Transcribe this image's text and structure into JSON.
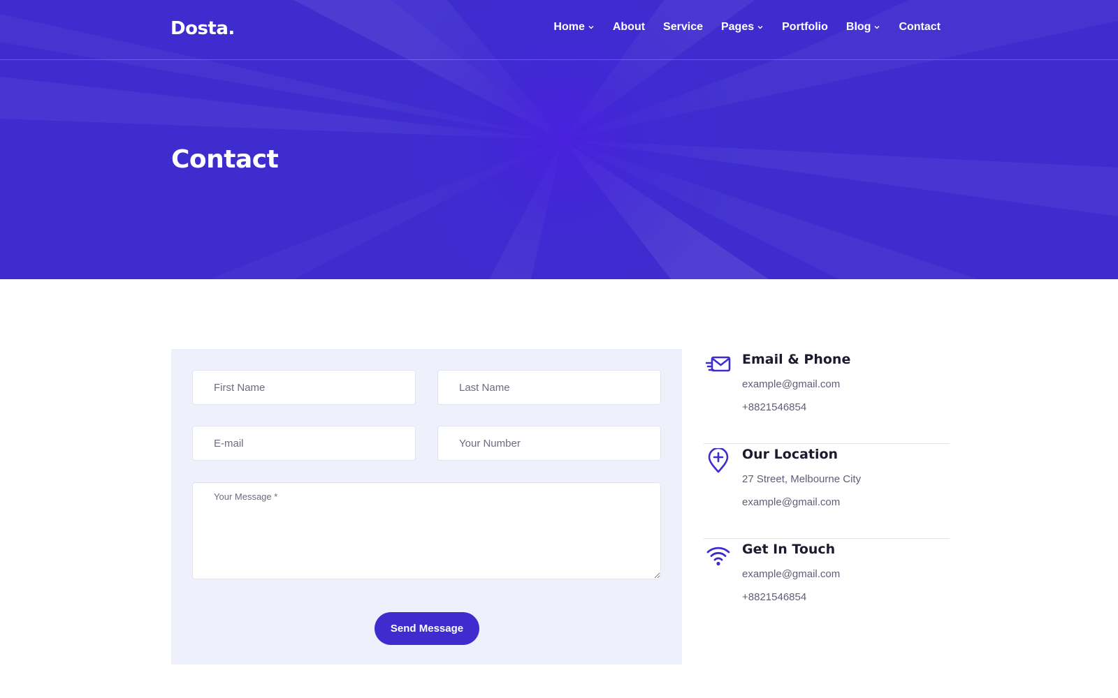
{
  "header": {
    "logo": "Dosta.",
    "nav": [
      {
        "label": "Home",
        "has_dropdown": true
      },
      {
        "label": "About",
        "has_dropdown": false
      },
      {
        "label": "Service",
        "has_dropdown": false
      },
      {
        "label": "Pages",
        "has_dropdown": true
      },
      {
        "label": "Portfolio",
        "has_dropdown": false
      },
      {
        "label": "Blog",
        "has_dropdown": true
      },
      {
        "label": "Contact",
        "has_dropdown": false
      }
    ]
  },
  "hero": {
    "title": "Contact",
    "background_color": "#3e2ccf"
  },
  "form": {
    "first_name_placeholder": "First Name",
    "last_name_placeholder": "Last Name",
    "email_placeholder": "E-mail",
    "number_placeholder": "Your Number",
    "message_placeholder": "Your Message *",
    "submit_label": "Send Message",
    "panel_color": "#eef0fb",
    "accent_color": "#3e2ccf"
  },
  "contact_info": [
    {
      "icon": "mail-icon",
      "title": "Email & Phone",
      "lines": [
        "example@gmail.com",
        "+8821546854"
      ]
    },
    {
      "icon": "location-pin-icon",
      "title": "Our Location",
      "lines": [
        "27 Street, Melbourne City",
        "example@gmail.com"
      ]
    },
    {
      "icon": "wifi-icon",
      "title": "Get In Touch",
      "lines": [
        "example@gmail.com",
        "+8821546854"
      ]
    }
  ]
}
